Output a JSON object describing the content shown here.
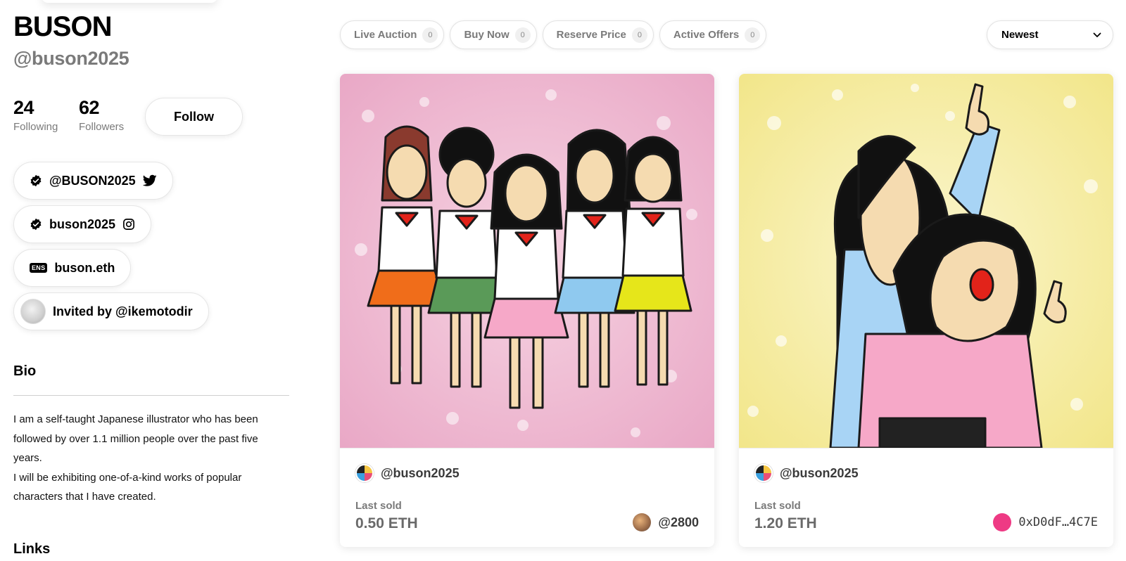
{
  "profile": {
    "display_name": "BUSON",
    "handle": "@buson2025",
    "following_count": "24",
    "following_label": "Following",
    "followers_count": "62",
    "followers_label": "Followers",
    "follow_label": "Follow",
    "twitter": "@BUSON2025",
    "instagram": "buson2025",
    "ens": "buson.eth",
    "ens_badge": "ENS",
    "invited_by": "Invited by @ikemotodir",
    "bio_title": "Bio",
    "bio_lines": [
      "I am a self-taught Japanese illustrator who has been followed by over 1.1 million people over the past five years.",
      "I will be exhibiting one-of-a-kind works of popular characters that I have created."
    ],
    "links_title": "Links"
  },
  "filters": [
    {
      "label": "Live Auction",
      "count": "0"
    },
    {
      "label": "Buy Now",
      "count": "0"
    },
    {
      "label": "Reserve Price",
      "count": "0"
    },
    {
      "label": "Active Offers",
      "count": "0"
    }
  ],
  "sort": {
    "selected": "Newest"
  },
  "cards": [
    {
      "creator": "@buson2025",
      "sold_label": "Last sold",
      "price": "0.50 ETH",
      "owner": "@2800",
      "art": "five schoolgirls in sailor uniforms on pink sparkle background"
    },
    {
      "creator": "@buson2025",
      "sold_label": "Last sold",
      "price": "1.20 ETH",
      "owner": "0xD0dF…4C7E",
      "art": "two characters pointing upward on yellow sparkle background"
    }
  ],
  "colors": {
    "muted_text": "#7a7a7a",
    "card1_bg": "#f0b8cf",
    "card2_bg": "#f7ef9a",
    "owner2_dot": "#ee3a84"
  }
}
